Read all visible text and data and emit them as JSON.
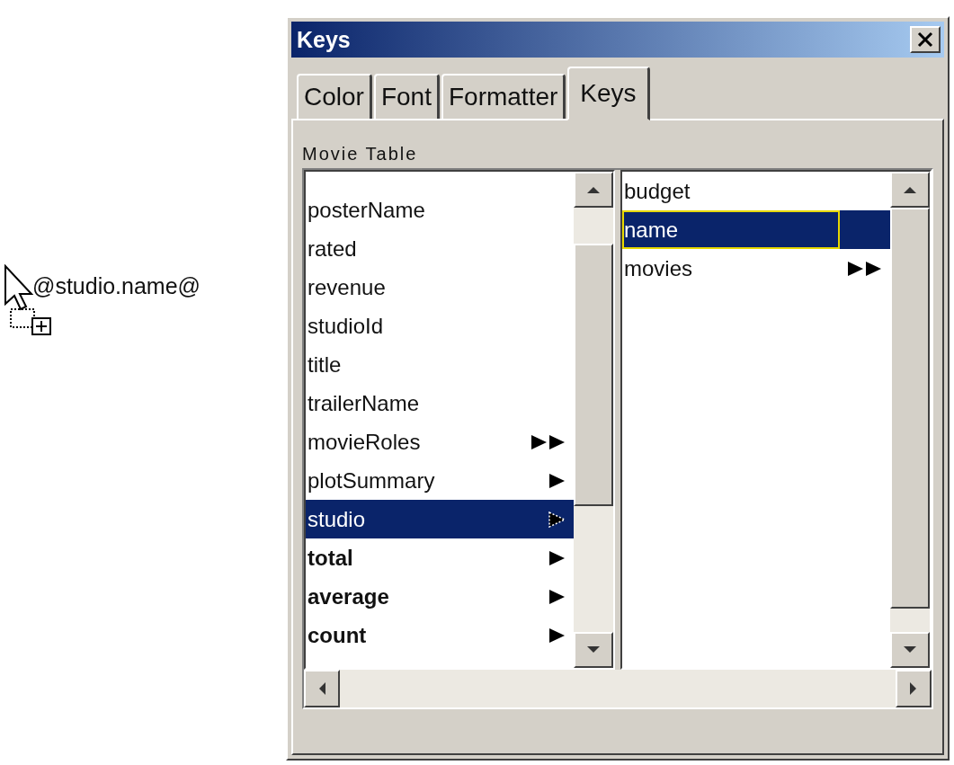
{
  "drag_text": "@studio.name@",
  "window": {
    "title": "Keys"
  },
  "tabs": [
    {
      "label": "Color",
      "selected": false
    },
    {
      "label": "Font",
      "selected": false
    },
    {
      "label": "Formatter",
      "selected": false
    },
    {
      "label": "Keys",
      "selected": true
    }
  ],
  "group_label": "Movie Table",
  "left_list": [
    {
      "label": "posterName",
      "bold": false,
      "kind": "plain",
      "selected": false
    },
    {
      "label": "rated",
      "bold": false,
      "kind": "plain",
      "selected": false
    },
    {
      "label": "revenue",
      "bold": false,
      "kind": "plain",
      "selected": false
    },
    {
      "label": "studioId",
      "bold": false,
      "kind": "plain",
      "selected": false
    },
    {
      "label": "title",
      "bold": false,
      "kind": "plain",
      "selected": false
    },
    {
      "label": "trailerName",
      "bold": false,
      "kind": "plain",
      "selected": false
    },
    {
      "label": "movieRoles",
      "bold": false,
      "kind": "double",
      "selected": false
    },
    {
      "label": "plotSummary",
      "bold": false,
      "kind": "single",
      "selected": false
    },
    {
      "label": "studio",
      "bold": false,
      "kind": "single",
      "selected": true
    },
    {
      "label": "total",
      "bold": true,
      "kind": "single",
      "selected": false
    },
    {
      "label": "average",
      "bold": true,
      "kind": "single",
      "selected": false
    },
    {
      "label": "count",
      "bold": true,
      "kind": "single",
      "selected": false
    }
  ],
  "right_list": [
    {
      "label": "budget",
      "bold": false,
      "kind": "plain",
      "selected": false
    },
    {
      "label": "name",
      "bold": false,
      "kind": "plain",
      "selected": true
    },
    {
      "label": "movies",
      "bold": false,
      "kind": "double",
      "selected": false
    }
  ]
}
